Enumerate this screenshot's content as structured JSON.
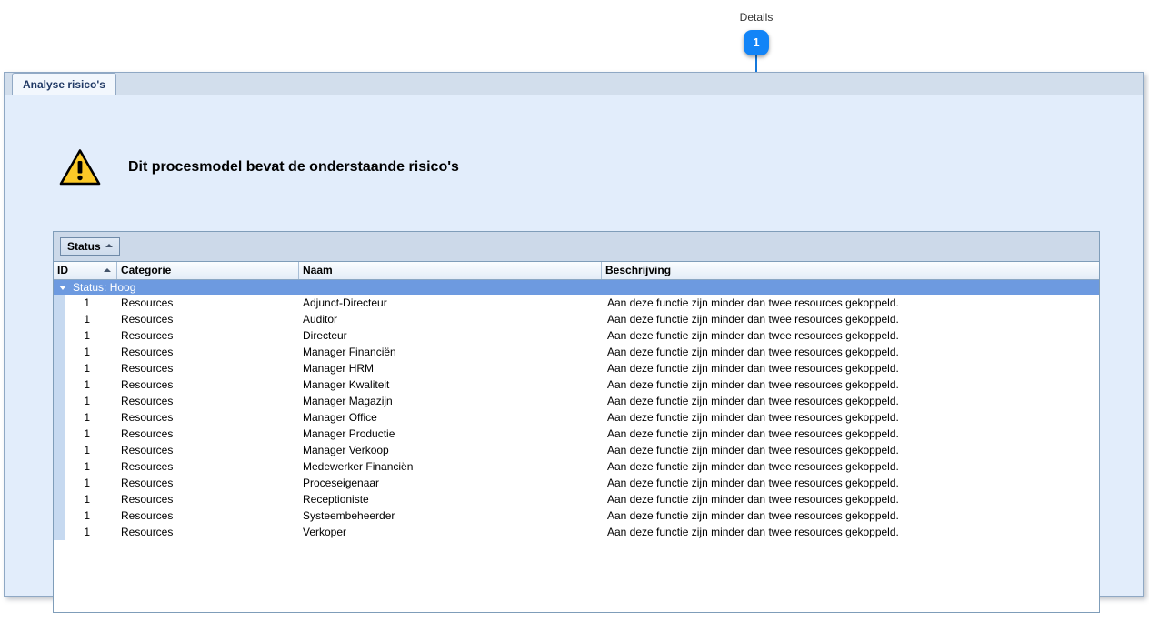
{
  "callout": {
    "label": "Details",
    "badge_number": "1",
    "accent_color": "#1284f7"
  },
  "window": {
    "tabs": [
      {
        "label": "Analyse risico's",
        "active": true
      }
    ],
    "heading": {
      "icon": "warning-triangle-icon",
      "text": "Dit procesmodel bevat de onderstaande risico's"
    }
  },
  "grid": {
    "toolbar": {
      "group_button_label": "Status",
      "group_button_sort": "ascending"
    },
    "columns": [
      {
        "key": "id",
        "label": "ID",
        "sorted": "ascending"
      },
      {
        "key": "categorie",
        "label": "Categorie",
        "sorted": ""
      },
      {
        "key": "naam",
        "label": "Naam",
        "sorted": ""
      },
      {
        "key": "beschrijving",
        "label": "Beschrijving",
        "sorted": ""
      }
    ],
    "group": {
      "label": "Status: Hoog",
      "expanded": true
    },
    "rows": [
      {
        "id": "1",
        "categorie": "Resources",
        "naam": "Adjunct-Directeur",
        "beschrijving": "Aan deze functie zijn minder dan twee resources gekoppeld."
      },
      {
        "id": "1",
        "categorie": "Resources",
        "naam": "Auditor",
        "beschrijving": "Aan deze functie zijn minder dan twee resources gekoppeld."
      },
      {
        "id": "1",
        "categorie": "Resources",
        "naam": "Directeur",
        "beschrijving": "Aan deze functie zijn minder dan twee resources gekoppeld."
      },
      {
        "id": "1",
        "categorie": "Resources",
        "naam": "Manager Financiën",
        "beschrijving": "Aan deze functie zijn minder dan twee resources gekoppeld."
      },
      {
        "id": "1",
        "categorie": "Resources",
        "naam": "Manager HRM",
        "beschrijving": "Aan deze functie zijn minder dan twee resources gekoppeld."
      },
      {
        "id": "1",
        "categorie": "Resources",
        "naam": "Manager Kwaliteit",
        "beschrijving": "Aan deze functie zijn minder dan twee resources gekoppeld."
      },
      {
        "id": "1",
        "categorie": "Resources",
        "naam": "Manager Magazijn",
        "beschrijving": "Aan deze functie zijn minder dan twee resources gekoppeld."
      },
      {
        "id": "1",
        "categorie": "Resources",
        "naam": "Manager Office",
        "beschrijving": "Aan deze functie zijn minder dan twee resources gekoppeld."
      },
      {
        "id": "1",
        "categorie": "Resources",
        "naam": "Manager Productie",
        "beschrijving": "Aan deze functie zijn minder dan twee resources gekoppeld."
      },
      {
        "id": "1",
        "categorie": "Resources",
        "naam": "Manager Verkoop",
        "beschrijving": "Aan deze functie zijn minder dan twee resources gekoppeld."
      },
      {
        "id": "1",
        "categorie": "Resources",
        "naam": "Medewerker Financiën",
        "beschrijving": "Aan deze functie zijn minder dan twee resources gekoppeld."
      },
      {
        "id": "1",
        "categorie": "Resources",
        "naam": "Proceseigenaar",
        "beschrijving": "Aan deze functie zijn minder dan twee resources gekoppeld."
      },
      {
        "id": "1",
        "categorie": "Resources",
        "naam": "Receptioniste",
        "beschrijving": "Aan deze functie zijn minder dan twee resources gekoppeld."
      },
      {
        "id": "1",
        "categorie": "Resources",
        "naam": "Systeembeheerder",
        "beschrijving": "Aan deze functie zijn minder dan twee resources gekoppeld."
      },
      {
        "id": "1",
        "categorie": "Resources",
        "naam": "Verkoper",
        "beschrijving": "Aan deze functie zijn minder dan twee resources gekoppeld."
      }
    ]
  }
}
